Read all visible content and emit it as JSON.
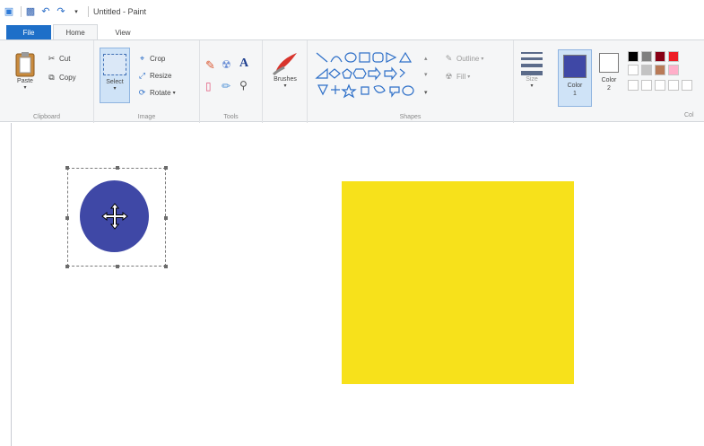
{
  "window": {
    "title": "Untitled - Paint"
  },
  "ribbon_tabs": {
    "file": "File",
    "home": "Home",
    "view": "View"
  },
  "clipboard": {
    "paste": "Paste",
    "cut": "Cut",
    "copy": "Copy",
    "label": "Clipboard"
  },
  "image": {
    "select": "Select",
    "crop": "Crop",
    "resize": "Resize",
    "rotate": "Rotate",
    "label": "Image"
  },
  "tools": {
    "label": "Tools"
  },
  "brushes": {
    "label": "Brushes"
  },
  "shapes": {
    "outline": "Outline",
    "fill": "Fill",
    "label": "Shapes"
  },
  "size": {
    "label": "Size"
  },
  "colors": {
    "color1": "Color 1",
    "color2": "Color 2",
    "color1_value": "#3f48a6",
    "color2_value": "#ffffff",
    "label": "Col",
    "palette_row1": [
      "#000000",
      "#7f7f7f",
      "#880015",
      "#ed1c24"
    ],
    "palette_row2": [
      "#ffffff",
      "#c3c3c3",
      "#b97a57",
      "#ffaec9"
    ]
  },
  "canvas": {
    "circle_color": "#3f48a6",
    "rect_color": "#f7e11b"
  }
}
